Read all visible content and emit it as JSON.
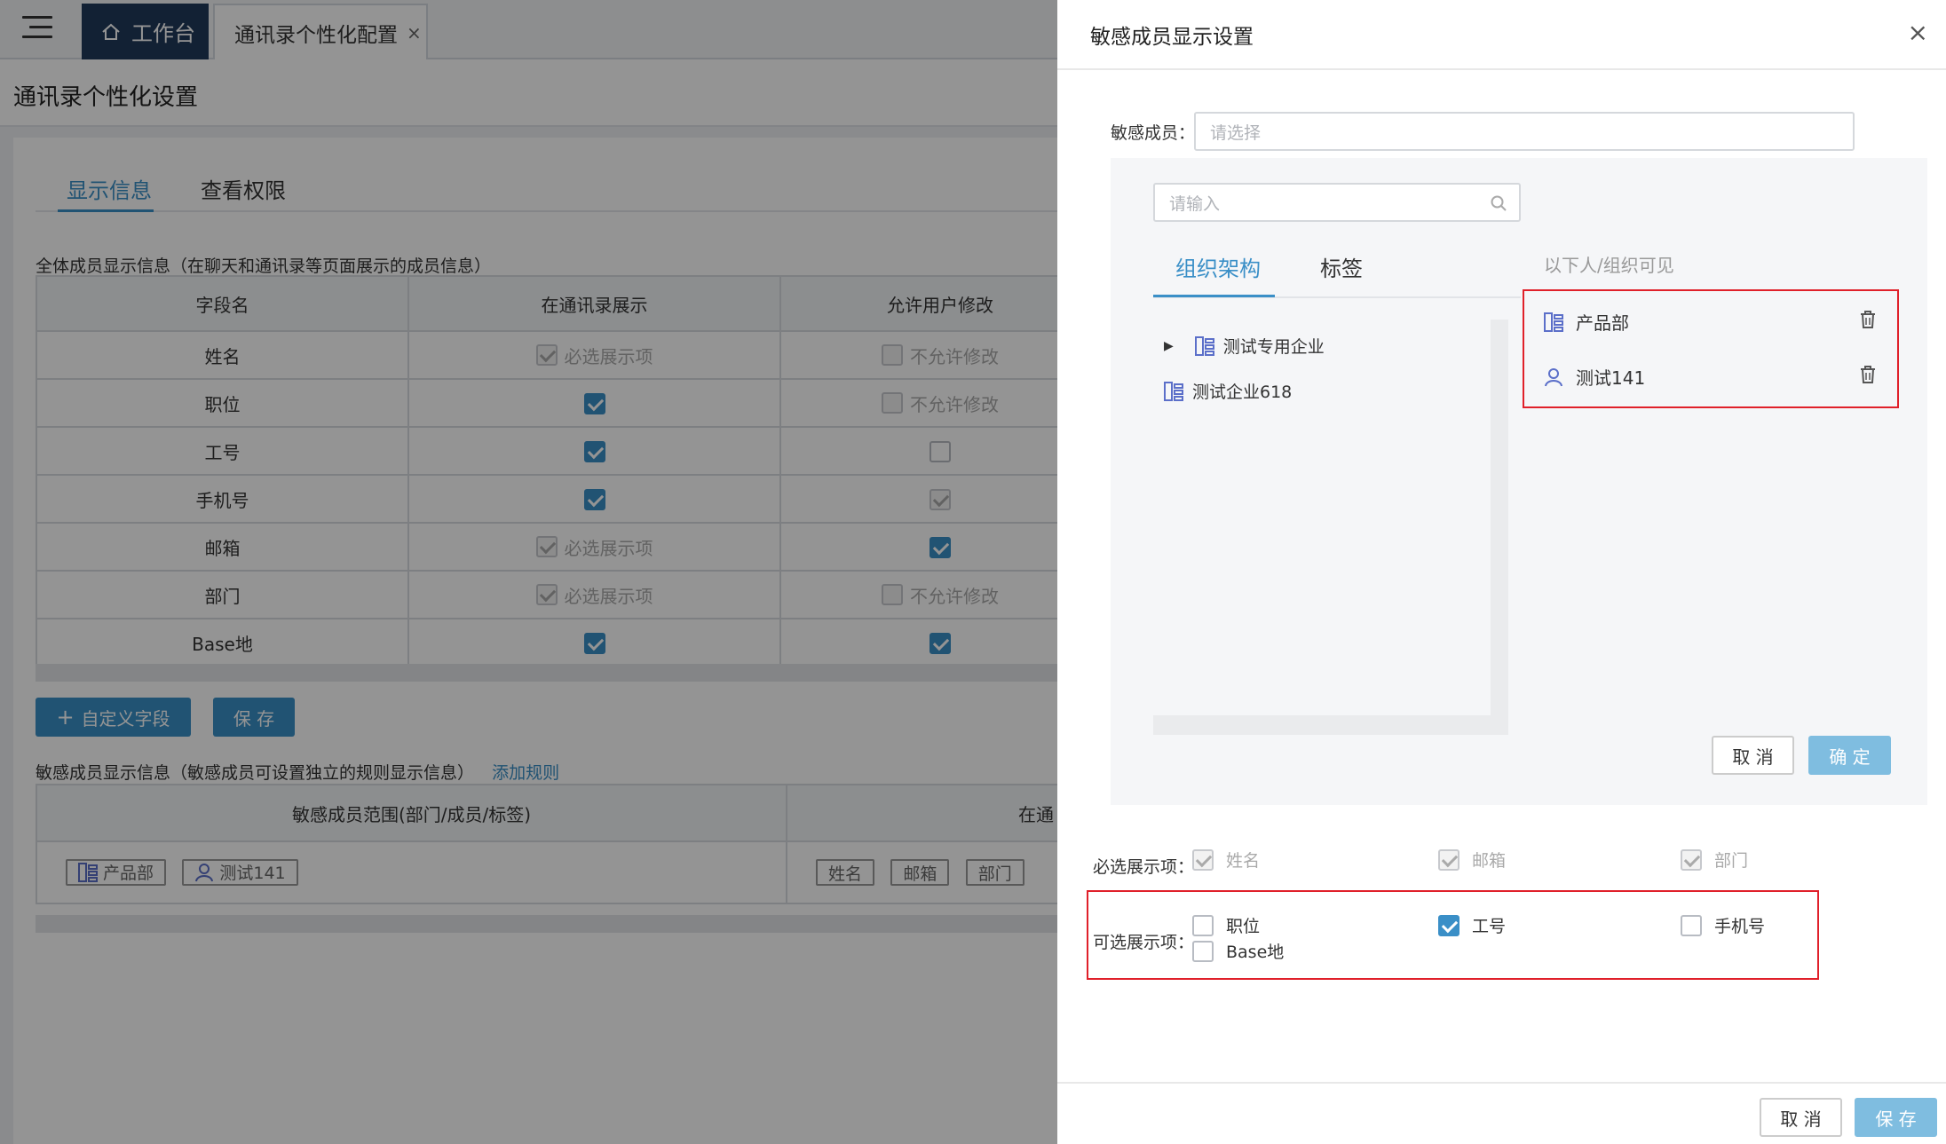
{
  "topbar": {
    "home_tab": "工作台",
    "config_tab": "通讯录个性化配置",
    "close_glyph": "×"
  },
  "page_title": "通讯录个性化设置",
  "tabs": [
    "显示信息",
    "查看权限"
  ],
  "all_members": {
    "title": "全体成员显示信息（在聊天和通讯录等页面展示的成员信息）",
    "headers": [
      "字段名",
      "在通讯录展示",
      "允许用户修改"
    ],
    "rows": [
      {
        "field": "姓名",
        "show": "必选展示项",
        "edit": "不允许修改"
      },
      {
        "field": "职位",
        "show": "checked",
        "edit": "不允许修改"
      },
      {
        "field": "工号",
        "show": "checked",
        "edit": "unchecked"
      },
      {
        "field": "手机号",
        "show": "checked",
        "edit": "checked-disabled"
      },
      {
        "field": "邮箱",
        "show": "必选展示项",
        "edit": "checked"
      },
      {
        "field": "部门",
        "show": "必选展示项",
        "edit": "不允许修改"
      },
      {
        "field": "Base地",
        "show": "checked",
        "edit": "checked"
      }
    ],
    "custom_field_btn": "自定义字段",
    "save_btn": "保 存"
  },
  "sensitive_section": {
    "title": "敏感成员显示信息（敏感成员可设置独立的规则显示信息）",
    "add_rule_link": "添加规则",
    "headers": [
      "敏感成员范围(部门/成员/标签)",
      "在通"
    ],
    "range_chips": [
      "产品部",
      "测试141"
    ],
    "field_chips": [
      "姓名",
      "邮箱",
      "部门"
    ]
  },
  "drawer": {
    "title": "敏感成员显示设置",
    "close_glyph": "×",
    "member_label": "敏感成员：",
    "member_placeholder": "请选择",
    "search_placeholder": "请输入",
    "picker_tabs": [
      "组织架构",
      "标签"
    ],
    "visible_label": "以下人/组织可见",
    "tree_nodes": [
      "测试专用企业",
      "测试企业618"
    ],
    "selected": [
      "产品部",
      "测试141"
    ],
    "picker_cancel": "取 消",
    "picker_confirm": "确 定",
    "required_label": "必选展示项：",
    "required_items": [
      "姓名",
      "邮箱",
      "部门"
    ],
    "optional_label": "可选展示项：",
    "optional_items": [
      {
        "label": "职位",
        "checked": false
      },
      {
        "label": "工号",
        "checked": true
      },
      {
        "label": "手机号",
        "checked": false
      },
      {
        "label": "Base地",
        "checked": false
      }
    ],
    "footer_cancel": "取 消",
    "footer_save": "保 存"
  },
  "colors": {
    "accent": "#3a8fc7",
    "nav_dark": "#1f3a5a",
    "highlight": "#e0202a"
  }
}
